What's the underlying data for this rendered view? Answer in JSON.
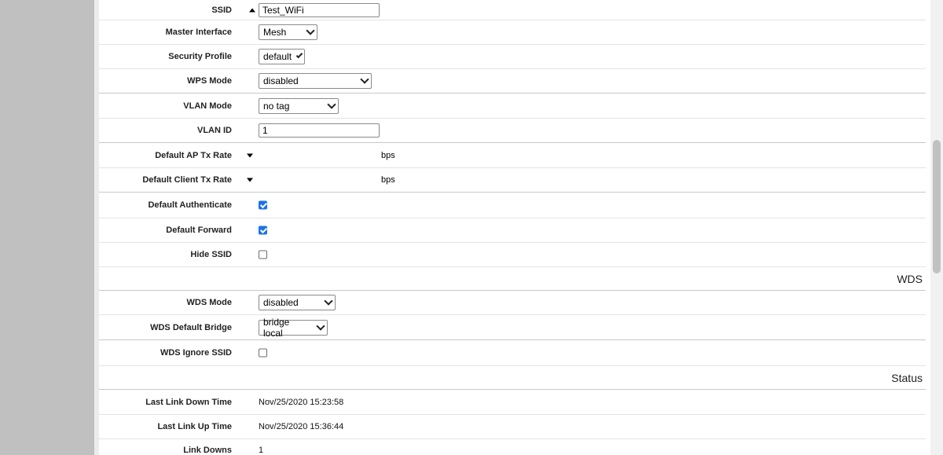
{
  "fields": {
    "ssid": {
      "label": "SSID",
      "value": "Test_WiFi"
    },
    "master_interface": {
      "label": "Master Interface",
      "value": "Mesh"
    },
    "security_profile": {
      "label": "Security Profile",
      "value": "default"
    },
    "wps_mode": {
      "label": "WPS Mode",
      "value": "disabled"
    },
    "vlan_mode": {
      "label": "VLAN Mode",
      "value": "no tag"
    },
    "vlan_id": {
      "label": "VLAN ID",
      "value": "1"
    },
    "default_ap_tx_rate": {
      "label": "Default AP Tx Rate",
      "unit": "bps"
    },
    "default_client_tx_rate": {
      "label": "Default Client Tx Rate",
      "unit": "bps"
    },
    "default_authenticate": {
      "label": "Default Authenticate",
      "checked": true
    },
    "default_forward": {
      "label": "Default Forward",
      "checked": true
    },
    "hide_ssid": {
      "label": "Hide SSID",
      "checked": false
    }
  },
  "wds": {
    "section_title": "WDS",
    "wds_mode": {
      "label": "WDS Mode",
      "value": "disabled"
    },
    "wds_default_bridge": {
      "label": "WDS Default Bridge",
      "value": "bridge local"
    },
    "wds_ignore_ssid": {
      "label": "WDS Ignore SSID",
      "checked": false
    }
  },
  "status": {
    "section_title": "Status",
    "last_link_down_time": {
      "label": "Last Link Down Time",
      "value": "Nov/25/2020 15:23:58"
    },
    "last_link_up_time": {
      "label": "Last Link Up Time",
      "value": "Nov/25/2020 15:36:44"
    },
    "link_downs": {
      "label": "Link Downs",
      "value": "1"
    }
  },
  "colors": {
    "left_bar": "#c0c0c0",
    "checkbox_checked": "#1a73e8"
  },
  "icons": {
    "collapse": "triangle-up-icon",
    "expand": "triangle-down-icon",
    "dropdown": "chevron-down-icon"
  }
}
